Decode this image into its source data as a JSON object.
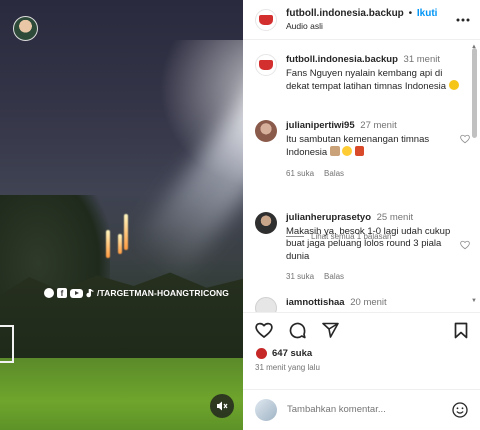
{
  "video": {
    "watermark_handle": "/TARGETMAN-HOANGTRICONG",
    "watermark_letter": "f"
  },
  "header": {
    "username": "futboll.indonesia.backup",
    "follow_label": "Ikuti",
    "dot": "•",
    "audio_label": "Audio asli",
    "more_icon": "more-horizontal-icon"
  },
  "caption": {
    "username": "futboll.indonesia.backup",
    "time": "31 menit",
    "text": "Fans Nguyen nyalain kembang api di dekat tempat latihan timnas Indonesia"
  },
  "comments": [
    {
      "username": "julianipertiwi95",
      "time": "27 menit",
      "text": "Itu sambutan kemenangan timnas Indonesia",
      "likes": "61 suka",
      "reply": "Balas",
      "avatar_color": "#8a5a4a"
    },
    {
      "username": "julianheruprasetyo",
      "time": "25 menit",
      "text": "Makasih ya, besok 1-0 lagi udah cukup buat jaga peluang lolos round 3 piala dunia",
      "likes": "31 suka",
      "reply": "Balas",
      "avatar_color": "#2f2f2f"
    },
    {
      "username": "iamnottishaa",
      "time": "20 menit",
      "avatar_color": "#e0e0e0"
    }
  ],
  "view_replies": "Lihat semua 1 balasan",
  "footer": {
    "likes": "647 suka",
    "time_ago": "31 menit yang lalu",
    "add_comment_placeholder": "Tambahkan komentar..."
  },
  "colors": {
    "accent": "#0095f6",
    "brand_red": "#d32f2f"
  }
}
